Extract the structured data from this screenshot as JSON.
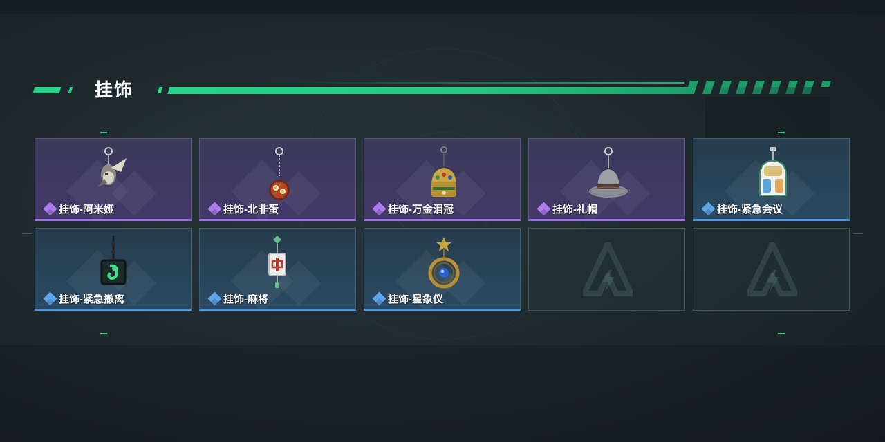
{
  "section": {
    "title": "挂饰"
  },
  "colors": {
    "accent": "#2ad188",
    "rarity_purple": "#9b6fe0",
    "rarity_blue": "#4b95df"
  },
  "items": [
    {
      "label": "挂饰-阿米娅",
      "rarity": "purple",
      "icon": "amiya-charm-icon"
    },
    {
      "label": "挂饰-北非蛋",
      "rarity": "purple",
      "icon": "shakshuka-charm-icon"
    },
    {
      "label": "挂饰-万金泪冠",
      "rarity": "purple",
      "icon": "jeweled-crown-charm-icon"
    },
    {
      "label": "挂饰-礼帽",
      "rarity": "purple",
      "icon": "top-hat-charm-icon"
    },
    {
      "label": "挂饰-紧急会议",
      "rarity": "blue",
      "icon": "emergency-meeting-charm-icon"
    },
    {
      "label": "挂饰-紧急撤离",
      "rarity": "blue",
      "icon": "emergency-evacuation-charm-icon"
    },
    {
      "label": "挂饰-麻将",
      "rarity": "blue",
      "icon": "mahjong-charm-icon"
    },
    {
      "label": "挂饰-星象仪",
      "rarity": "blue",
      "icon": "astrolabe-charm-icon"
    }
  ],
  "empty_slots": 2
}
